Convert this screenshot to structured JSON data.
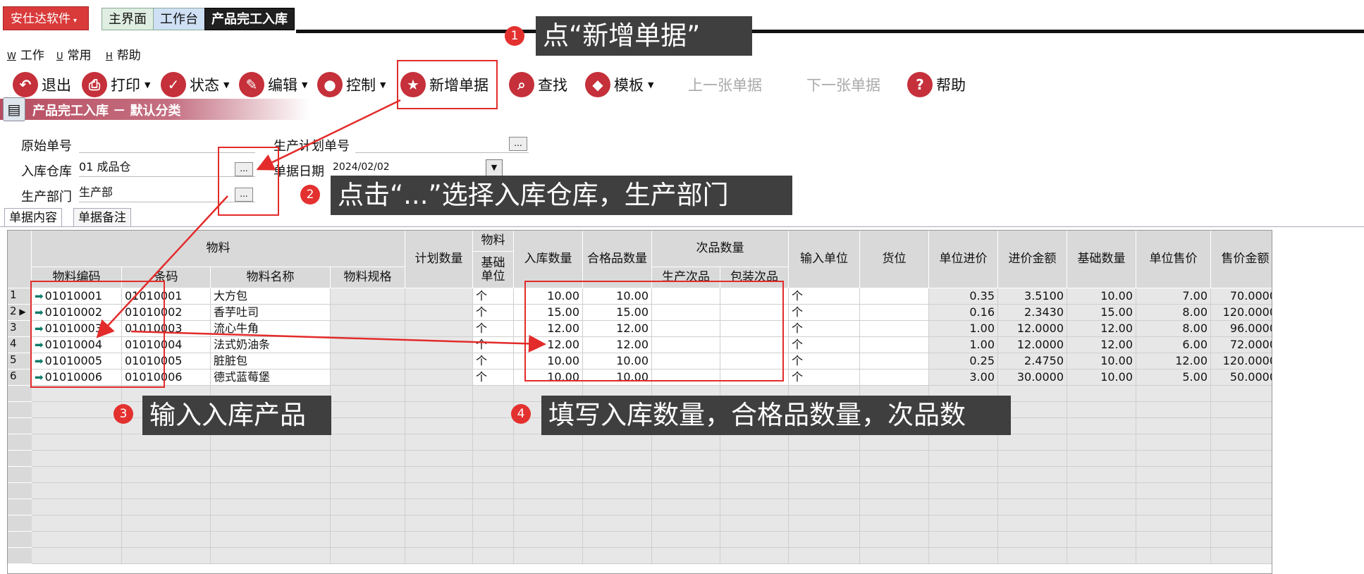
{
  "app": {
    "brand": "安仕达软件",
    "tabs": [
      "主界面",
      "工作台",
      "产品完工入库"
    ]
  },
  "menu": [
    {
      "key": "W",
      "label": "工作"
    },
    {
      "key": "U",
      "label": "常用"
    },
    {
      "key": "H",
      "label": "帮助"
    }
  ],
  "toolbar": {
    "exit": "退出",
    "print": "打印",
    "status": "状态",
    "edit": "编辑",
    "control": "控制",
    "new_doc": "新增单据",
    "find": "查找",
    "template": "模板",
    "prev": "上一张单据",
    "next": "下一张单据",
    "help": "帮助"
  },
  "section_title": "产品完工入库 － 默认分类",
  "form": {
    "original_no_label": "原始单号",
    "original_no_value": "",
    "plan_no_label": "生产计划单号",
    "plan_no_value": "",
    "warehouse_label": "入库仓库",
    "warehouse_value": "01 成品仓",
    "date_label": "单据日期",
    "date_value": "2024/02/02",
    "dept_label": "生产部门",
    "dept_value": "生产部",
    "ellipsis": "..."
  },
  "subtabs": [
    "单据内容",
    "单据备注"
  ],
  "table": {
    "group_material": "物料",
    "group_unit": "物料",
    "group_defect": "次品数量",
    "headers": {
      "code": "物料编码",
      "barcode": "条码",
      "name": "物料名称",
      "spec": "物料规格",
      "plan_qty": "计划数量",
      "base_unit": "基础单位",
      "in_qty": "入库数量",
      "good_qty": "合格品数量",
      "prod_defect": "生产次品",
      "pack_defect": "包装次品",
      "input_unit": "输入单位",
      "location": "货位",
      "unit_cost": "单位进价",
      "cost_amount": "进价金额",
      "base_qty": "基础数量",
      "unit_price": "单位售价",
      "price_amount": "售价金额"
    },
    "rows": [
      {
        "no": "1",
        "code": "01010001",
        "barcode": "01010001",
        "name": "大方包",
        "unit": "个",
        "in_qty": "10.00",
        "good_qty": "10.00",
        "input_unit": "个",
        "unit_cost": "0.35",
        "cost_amount": "3.5100",
        "base_qty": "10.00",
        "unit_price": "7.00",
        "price_amount": "70.0000"
      },
      {
        "no": "2",
        "code": "01010002",
        "barcode": "01010002",
        "name": "香芋吐司",
        "unit": "个",
        "in_qty": "15.00",
        "good_qty": "15.00",
        "input_unit": "个",
        "unit_cost": "0.16",
        "cost_amount": "2.3430",
        "base_qty": "15.00",
        "unit_price": "8.00",
        "price_amount": "120.0000"
      },
      {
        "no": "3",
        "code": "01010003",
        "barcode": "01010003",
        "name": "流心牛角",
        "unit": "个",
        "in_qty": "12.00",
        "good_qty": "12.00",
        "input_unit": "个",
        "unit_cost": "1.00",
        "cost_amount": "12.0000",
        "base_qty": "12.00",
        "unit_price": "8.00",
        "price_amount": "96.0000"
      },
      {
        "no": "4",
        "code": "01010004",
        "barcode": "01010004",
        "name": "法式奶油条",
        "unit": "个",
        "in_qty": "12.00",
        "good_qty": "12.00",
        "input_unit": "个",
        "unit_cost": "1.00",
        "cost_amount": "12.0000",
        "base_qty": "12.00",
        "unit_price": "6.00",
        "price_amount": "72.0000"
      },
      {
        "no": "5",
        "code": "01010005",
        "barcode": "01010005",
        "name": "脏脏包",
        "unit": "个",
        "in_qty": "10.00",
        "good_qty": "10.00",
        "input_unit": "个",
        "unit_cost": "0.25",
        "cost_amount": "2.4750",
        "base_qty": "10.00",
        "unit_price": "12.00",
        "price_amount": "120.0000"
      },
      {
        "no": "6",
        "code": "01010006",
        "barcode": "01010006",
        "name": "德式蓝莓堡",
        "unit": "个",
        "in_qty": "10.00",
        "good_qty": "10.00",
        "input_unit": "个",
        "unit_cost": "3.00",
        "cost_amount": "30.0000",
        "base_qty": "10.00",
        "unit_price": "5.00",
        "price_amount": "50.0000"
      }
    ]
  },
  "annotations": [
    {
      "num": "1",
      "text": "点“新增单据”"
    },
    {
      "num": "2",
      "text": "点击“...”选择入库仓库，生产部门"
    },
    {
      "num": "3",
      "text": "输入入库产品"
    },
    {
      "num": "4",
      "text": "填写入库数量，合格品数量，次品数"
    }
  ],
  "colors": {
    "accent_red": "#e32b2b",
    "callout_bg": "#3f3f3f",
    "brand_red": "#d93a3a"
  }
}
